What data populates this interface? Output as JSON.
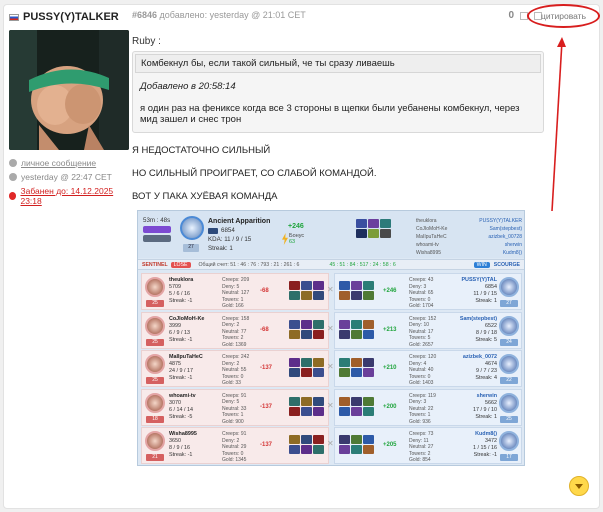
{
  "user": {
    "name": "PUSSY(Y)TALKER",
    "private_message": "личное сообщение",
    "last_seen": "yesterday @ 22:47 CET",
    "banned": "Забанен до: 14.12.2025 23:18"
  },
  "post": {
    "number": "#6846",
    "added": "добавлено: yesterday @ 21:01 CET",
    "votes": "0",
    "quote_label": "цитировать",
    "quote_author": "Ruby :",
    "quote_inner": "Комбекнул бы, если такой сильный, че ты сразу ливаешь",
    "quote_edited": "Добавлено в 20:58:14",
    "quote_text": "я один раз на фениксе когда все 3 стороны в щепки были уебанены комбекнул, через мид зашел и снес трон",
    "lines": [
      "Я НЕДОСТАТОЧНО СИЛЬНЫЙ",
      "НО СИЛЬНЫЙ ПРОИГРАЕТ, СО СЛАБОЙ КОМАНДОЙ.",
      "ВОТ У ПАКА ХУЁВАЯ КОМАНДА"
    ]
  },
  "match": {
    "duration": "53m : 48s",
    "hero": "Ancient Apparition",
    "mmr": "6854",
    "kda_label": "KDA:",
    "kda": "11 / 9 / 15",
    "streak": "Streak: 1",
    "level": "27",
    "gain": "+246",
    "bonus": "Бонус",
    "bonus_val": "63",
    "party": [
      {
        "l": "theuklora",
        "r": "PUSSY(Y)TALKER"
      },
      {
        "l": "CoJIoMoH-Ke",
        "r": "Sam(stepbest)"
      },
      {
        "l": "MaIIpuTaHeC",
        "r": "azizbek_00728"
      },
      {
        "l": "whoami-tv",
        "r": "sherwin"
      },
      {
        "l": "Wisha8995",
        "r": "Kudm8()"
      }
    ],
    "sentinel": "SENTINEL",
    "lose": "LOSE",
    "score": "Общий счет: 51 : 46 : 76 : 793 : 21 : 261 : 6",
    "score_right": "45 : 51 : 84 : 517 : 24 : 58 : 6",
    "win": "WIN",
    "scourge": "SCOURGE",
    "rows": [
      {
        "left": {
          "name": "theuklora",
          "mmr": "5709",
          "kda": "5 / 6 / 16",
          "streak": "Streak: -1",
          "lvl": "25",
          "creeps": "Creeps: 209",
          "deny": "Deny: 5",
          "neutral": "Neutral: 127",
          "towers": "Towers: 1",
          "gold": "Gold: 166",
          "delta": "-68"
        },
        "right": {
          "name": "PUSSY(Y)TAL",
          "mmr": "6854",
          "kda": "11 / 9 / 15",
          "streak": "Streak: 1",
          "lvl": "27",
          "creeps": "Creeps: 43",
          "deny": "Deny: 3",
          "neutral": "Neutral: 65",
          "towers": "Towers: 0",
          "gold": "Gold: 1704",
          "delta": "+246"
        }
      },
      {
        "left": {
          "name": "CoJIoMoH-Ke",
          "mmr": "3999",
          "kda": "6 / 9 / 13",
          "streak": "Streak: -1",
          "lvl": "25",
          "creeps": "Creeps: 158",
          "deny": "Deny: 2",
          "neutral": "Neutral: 77",
          "towers": "Towers: 2",
          "gold": "Gold: 1369",
          "delta": "-68"
        },
        "right": {
          "name": "Sam(stepbest)",
          "mmr": "6522",
          "kda": "8 / 9 / 18",
          "streak": "Streak: 5",
          "lvl": "24",
          "creeps": "Creeps: 152",
          "deny": "Deny: 10",
          "neutral": "Neutral: 17",
          "towers": "Towers: 5",
          "gold": "Gold: 2657",
          "delta": "+213"
        }
      },
      {
        "left": {
          "name": "MaIIpuTaHeC",
          "mmr": "4875",
          "kda": "24 / 9 / 17",
          "streak": "Streak: -1",
          "lvl": "25",
          "creeps": "Creeps: 242",
          "deny": "Deny: 2",
          "neutral": "Neutral: 55",
          "towers": "Towers: 0",
          "gold": "Gold: 33",
          "delta": "-137"
        },
        "right": {
          "name": "azizbek_0072",
          "mmr": "4674",
          "kda": "9 / 7 / 23",
          "streak": "Streak: 4",
          "lvl": "22",
          "creeps": "Creeps: 120",
          "deny": "Deny: 4",
          "neutral": "Neutral: 40",
          "towers": "Towers: 0",
          "gold": "Gold: 1403",
          "delta": "+210"
        }
      },
      {
        "left": {
          "name": "whoami-tv",
          "mmr": "3070",
          "kda": "6 / 14 / 14",
          "streak": "Streak: -5",
          "lvl": "18",
          "creeps": "Creeps: 91",
          "deny": "Deny: 5",
          "neutral": "Neutral: 33",
          "towers": "Towers: 1",
          "gold": "Gold: 900",
          "delta": "-137"
        },
        "right": {
          "name": "sherwin",
          "mmr": "5662",
          "kda": "17 / 9 / 10",
          "streak": "Streak: 1",
          "lvl": "25",
          "creeps": "Creeps: 119",
          "deny": "Deny: 3",
          "neutral": "Neutral: 22",
          "towers": "Towers: 1",
          "gold": "Gold: 936",
          "delta": "+200"
        }
      },
      {
        "left": {
          "name": "Wisha8995",
          "mmr": "3650",
          "kda": "8 / 9 / 16",
          "streak": "Streak: -1",
          "lvl": "21",
          "creeps": "Creeps: 91",
          "deny": "Deny: 2",
          "neutral": "Neutral: 29",
          "towers": "Towers: 0",
          "gold": "Gold: 1345",
          "delta": "-137"
        },
        "right": {
          "name": "Kudm8()",
          "mmr": "3472",
          "kda": "1 / 15 / 16",
          "streak": "Streak: -1",
          "lvl": "17",
          "creeps": "Creeps: 73",
          "deny": "Deny: 11",
          "neutral": "Neutral: 27",
          "towers": "Towers: 2",
          "gold": "Gold: 854",
          "delta": "+205"
        }
      }
    ]
  },
  "colors": {
    "ban": "#d21f1f",
    "highlight_ring": "#d81e1e",
    "win_blue": "#2d7fd6",
    "lose_red": "#e35050"
  }
}
